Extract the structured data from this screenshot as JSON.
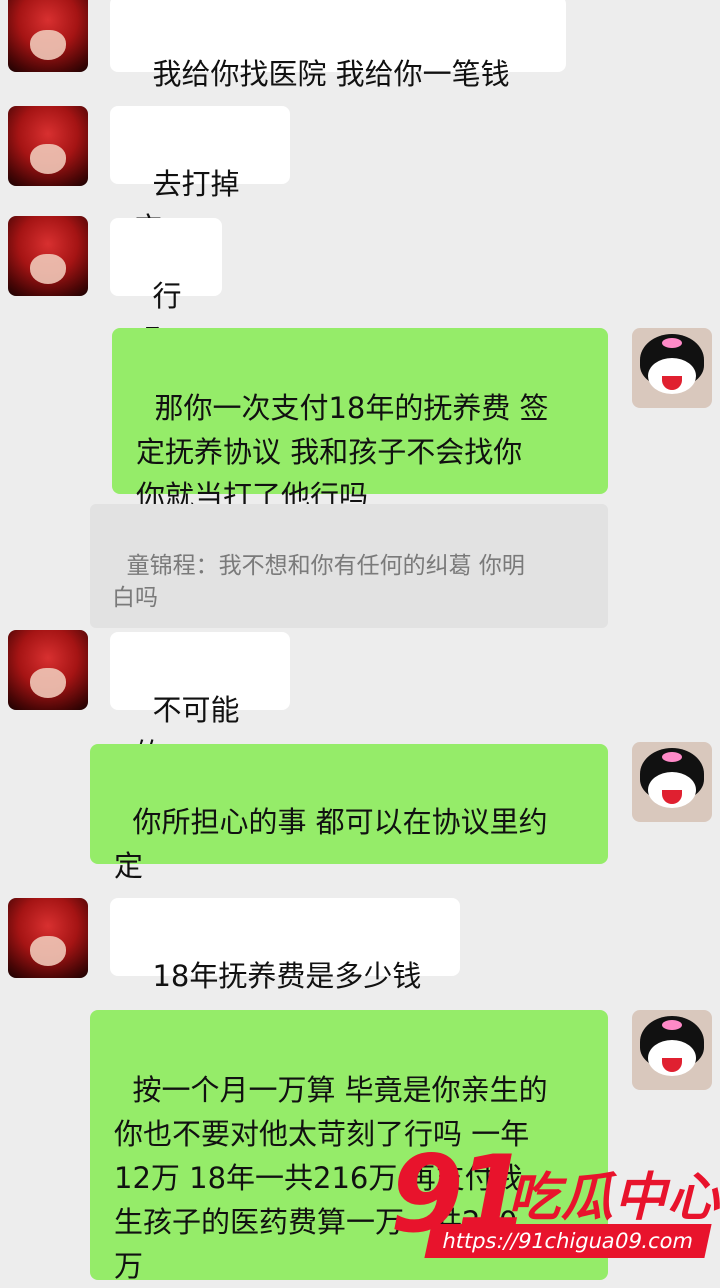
{
  "messages": [
    {
      "side": "left",
      "text": "我给你找医院 我给你一笔钱"
    },
    {
      "side": "left",
      "text": "去打掉它"
    },
    {
      "side": "left",
      "text": "行吗"
    },
    {
      "side": "right",
      "text": "那你一次支付18年的抚养费 签\n定抚养协议 我和孩子不会找你\n你就当打了他行吗"
    },
    {
      "side": "quote",
      "text": "童锦程：我不想和你有任何的纠葛 你明\n白吗"
    },
    {
      "side": "left",
      "text": "不可能的"
    },
    {
      "side": "right",
      "text": "你所担心的事 都可以在协议里约\n定"
    },
    {
      "side": "left",
      "text": "18年抚养费是多少钱"
    },
    {
      "side": "right",
      "text": "按一个月一万算 毕竟是你亲生的\n你也不要对他太苛刻了行吗 一年\n12万 18年一共216万 再支付我\n生孩子的医药费算一万一共220\n万"
    }
  ],
  "watermark": {
    "number": "91",
    "brand": "吃瓜中心",
    "url": "https://91chigua09.com"
  },
  "colors": {
    "background": "#ededed",
    "bubble_self": "#95ec69",
    "bubble_other": "#ffffff",
    "quote_bg": "#e2e2e2",
    "watermark_red": "#e8132c"
  },
  "icons": {
    "left_avatar": "red-hair-anime-avatar",
    "right_avatar": "kuromi-avatar"
  }
}
